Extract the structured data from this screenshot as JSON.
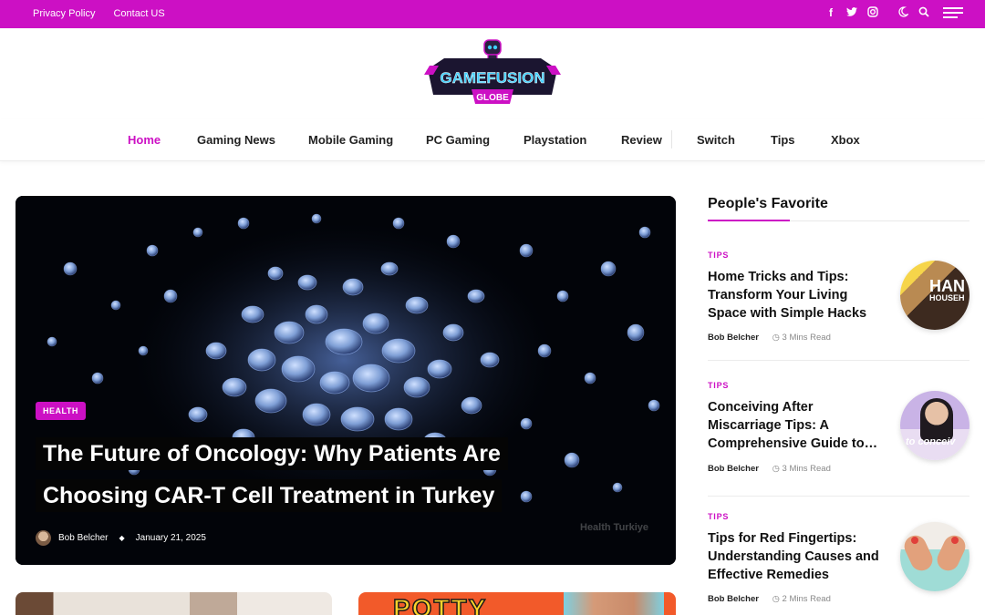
{
  "topbar": {
    "links": [
      "Privacy Policy",
      "Contact US"
    ],
    "icons": [
      "facebook-icon",
      "twitter-icon",
      "instagram-icon",
      "moon-icon",
      "search-icon",
      "menu-icon"
    ]
  },
  "logo": {
    "line1": "GAMEFUSION",
    "line2": "GLOBE"
  },
  "nav": {
    "items": [
      "Home",
      "Gaming News",
      "Mobile Gaming",
      "PC Gaming",
      "Playstation",
      "Review",
      "Switch",
      "Tips",
      "Xbox"
    ],
    "active": "Home"
  },
  "hero": {
    "category": "HEALTH",
    "title": "The Future of Oncology: Why Patients Are Choosing CAR-T Cell Treatment in Turkey",
    "author": "Bob Belcher",
    "date": "January 21, 2025",
    "watermark": "Health Turkiye"
  },
  "cards": [
    {
      "image_text": ""
    },
    {
      "image_text": "POTTY"
    }
  ],
  "sidebar": {
    "heading": "People's Favorite",
    "posts": [
      {
        "category": "TIPS",
        "title": "Home Tricks and Tips: Transform Your Living Space with Simple Hacks",
        "author": "Bob Belcher",
        "read_time": "3 Mins Read",
        "thumb_text": "HAN",
        "thumb_sub": "HOUSEH"
      },
      {
        "category": "TIPS",
        "title": "Conceiving After Miscarriage Tips: A Comprehensive Guide to…",
        "author": "Bob Belcher",
        "read_time": "3 Mins Read",
        "thumb_text": "to conceiv"
      },
      {
        "category": "TIPS",
        "title": "Tips for Red Fingertips: Understanding Causes and Effective Remedies",
        "author": "Bob Belcher",
        "read_time": "2 Mins Read"
      }
    ]
  },
  "colors": {
    "accent": "#cc10c4",
    "text": "#111111",
    "muted": "#888888"
  }
}
